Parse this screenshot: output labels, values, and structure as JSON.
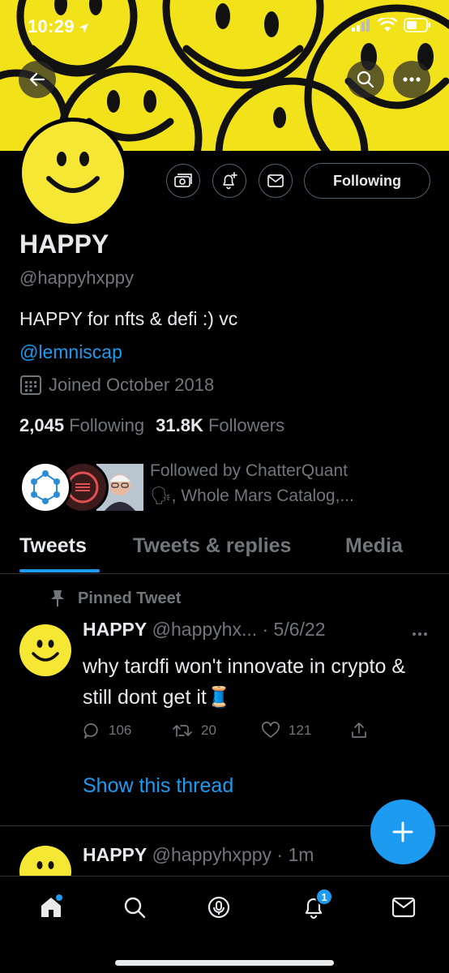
{
  "status_bar": {
    "time": "10:29"
  },
  "profile": {
    "name": "HAPPY",
    "handle": "@happyhxppy",
    "bio": "HAPPY for nfts & defi :) vc",
    "bio_link": "@lemniscap",
    "joined": "Joined October 2018",
    "following_count": "2,045",
    "following_label": "Following",
    "followers_count": "31.8K",
    "followers_label": "Followers",
    "followed_by_line1": "Followed by ChatterQuant",
    "followed_by_line2": "🗣, Whole Mars Catalog,..."
  },
  "actions": {
    "following_button": "Following"
  },
  "tabs": [
    {
      "label": "Tweets",
      "active": true
    },
    {
      "label": "Tweets & replies",
      "active": false
    },
    {
      "label": "Media",
      "active": false
    }
  ],
  "pinned_tweet": {
    "pinned_label": "Pinned Tweet",
    "name": "HAPPY",
    "handle_date": "@happyhx... · 5/6/22",
    "text": "why tardfi won't innovate in crypto & still dont get it🧵",
    "replies": "106",
    "retweets": "20",
    "likes": "121",
    "show_thread": "Show this thread"
  },
  "next_tweet": {
    "name": "HAPPY",
    "handle_time": "@happyhxppy · 1m"
  },
  "bottom_nav": {
    "notification_badge": "1"
  },
  "colors": {
    "accent": "#1d9bf0",
    "banner_yellow": "#f2e21a",
    "text_primary": "#e7e9ea",
    "text_secondary": "#71767b"
  }
}
